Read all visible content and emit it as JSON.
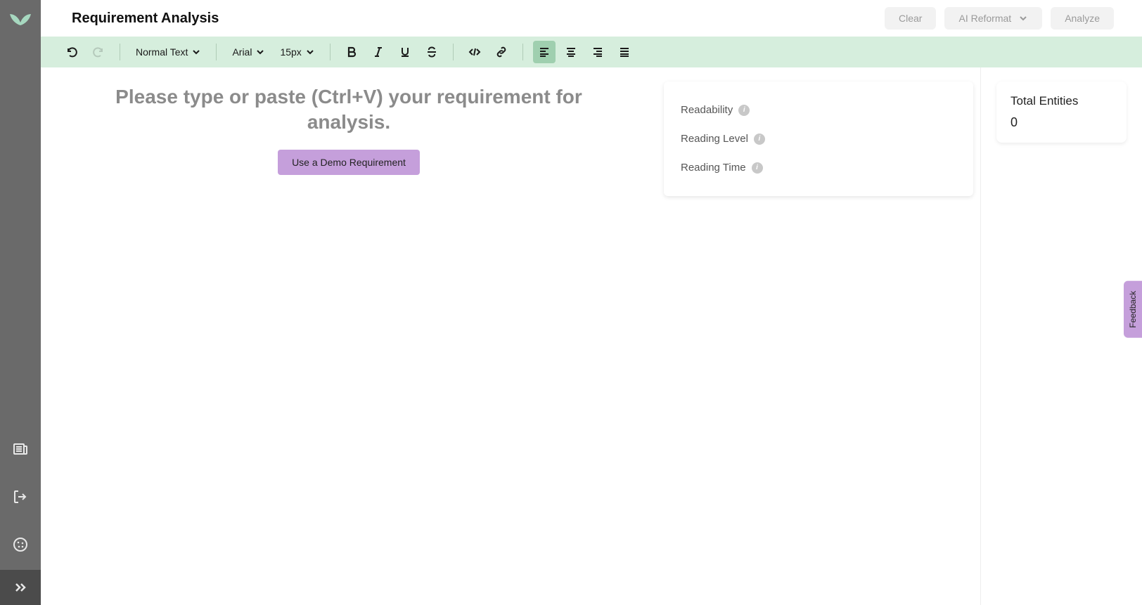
{
  "header": {
    "title": "Requirement Analysis",
    "buttons": {
      "clear": "Clear",
      "ai_reformat": "AI Reformat",
      "analyze": "Analyze"
    }
  },
  "toolbar": {
    "text_style": "Normal Text",
    "font": "Arial",
    "font_size": "15px"
  },
  "editor": {
    "placeholder": "Please type or paste (Ctrl+V) your requirement for analysis.",
    "demo_button": "Use a Demo Requirement"
  },
  "metrics": {
    "readability": "Readability",
    "reading_level": "Reading Level",
    "reading_time": "Reading Time"
  },
  "right": {
    "total_entities_label": "Total Entities",
    "total_entities_count": "0"
  },
  "feedback": "Feedback"
}
